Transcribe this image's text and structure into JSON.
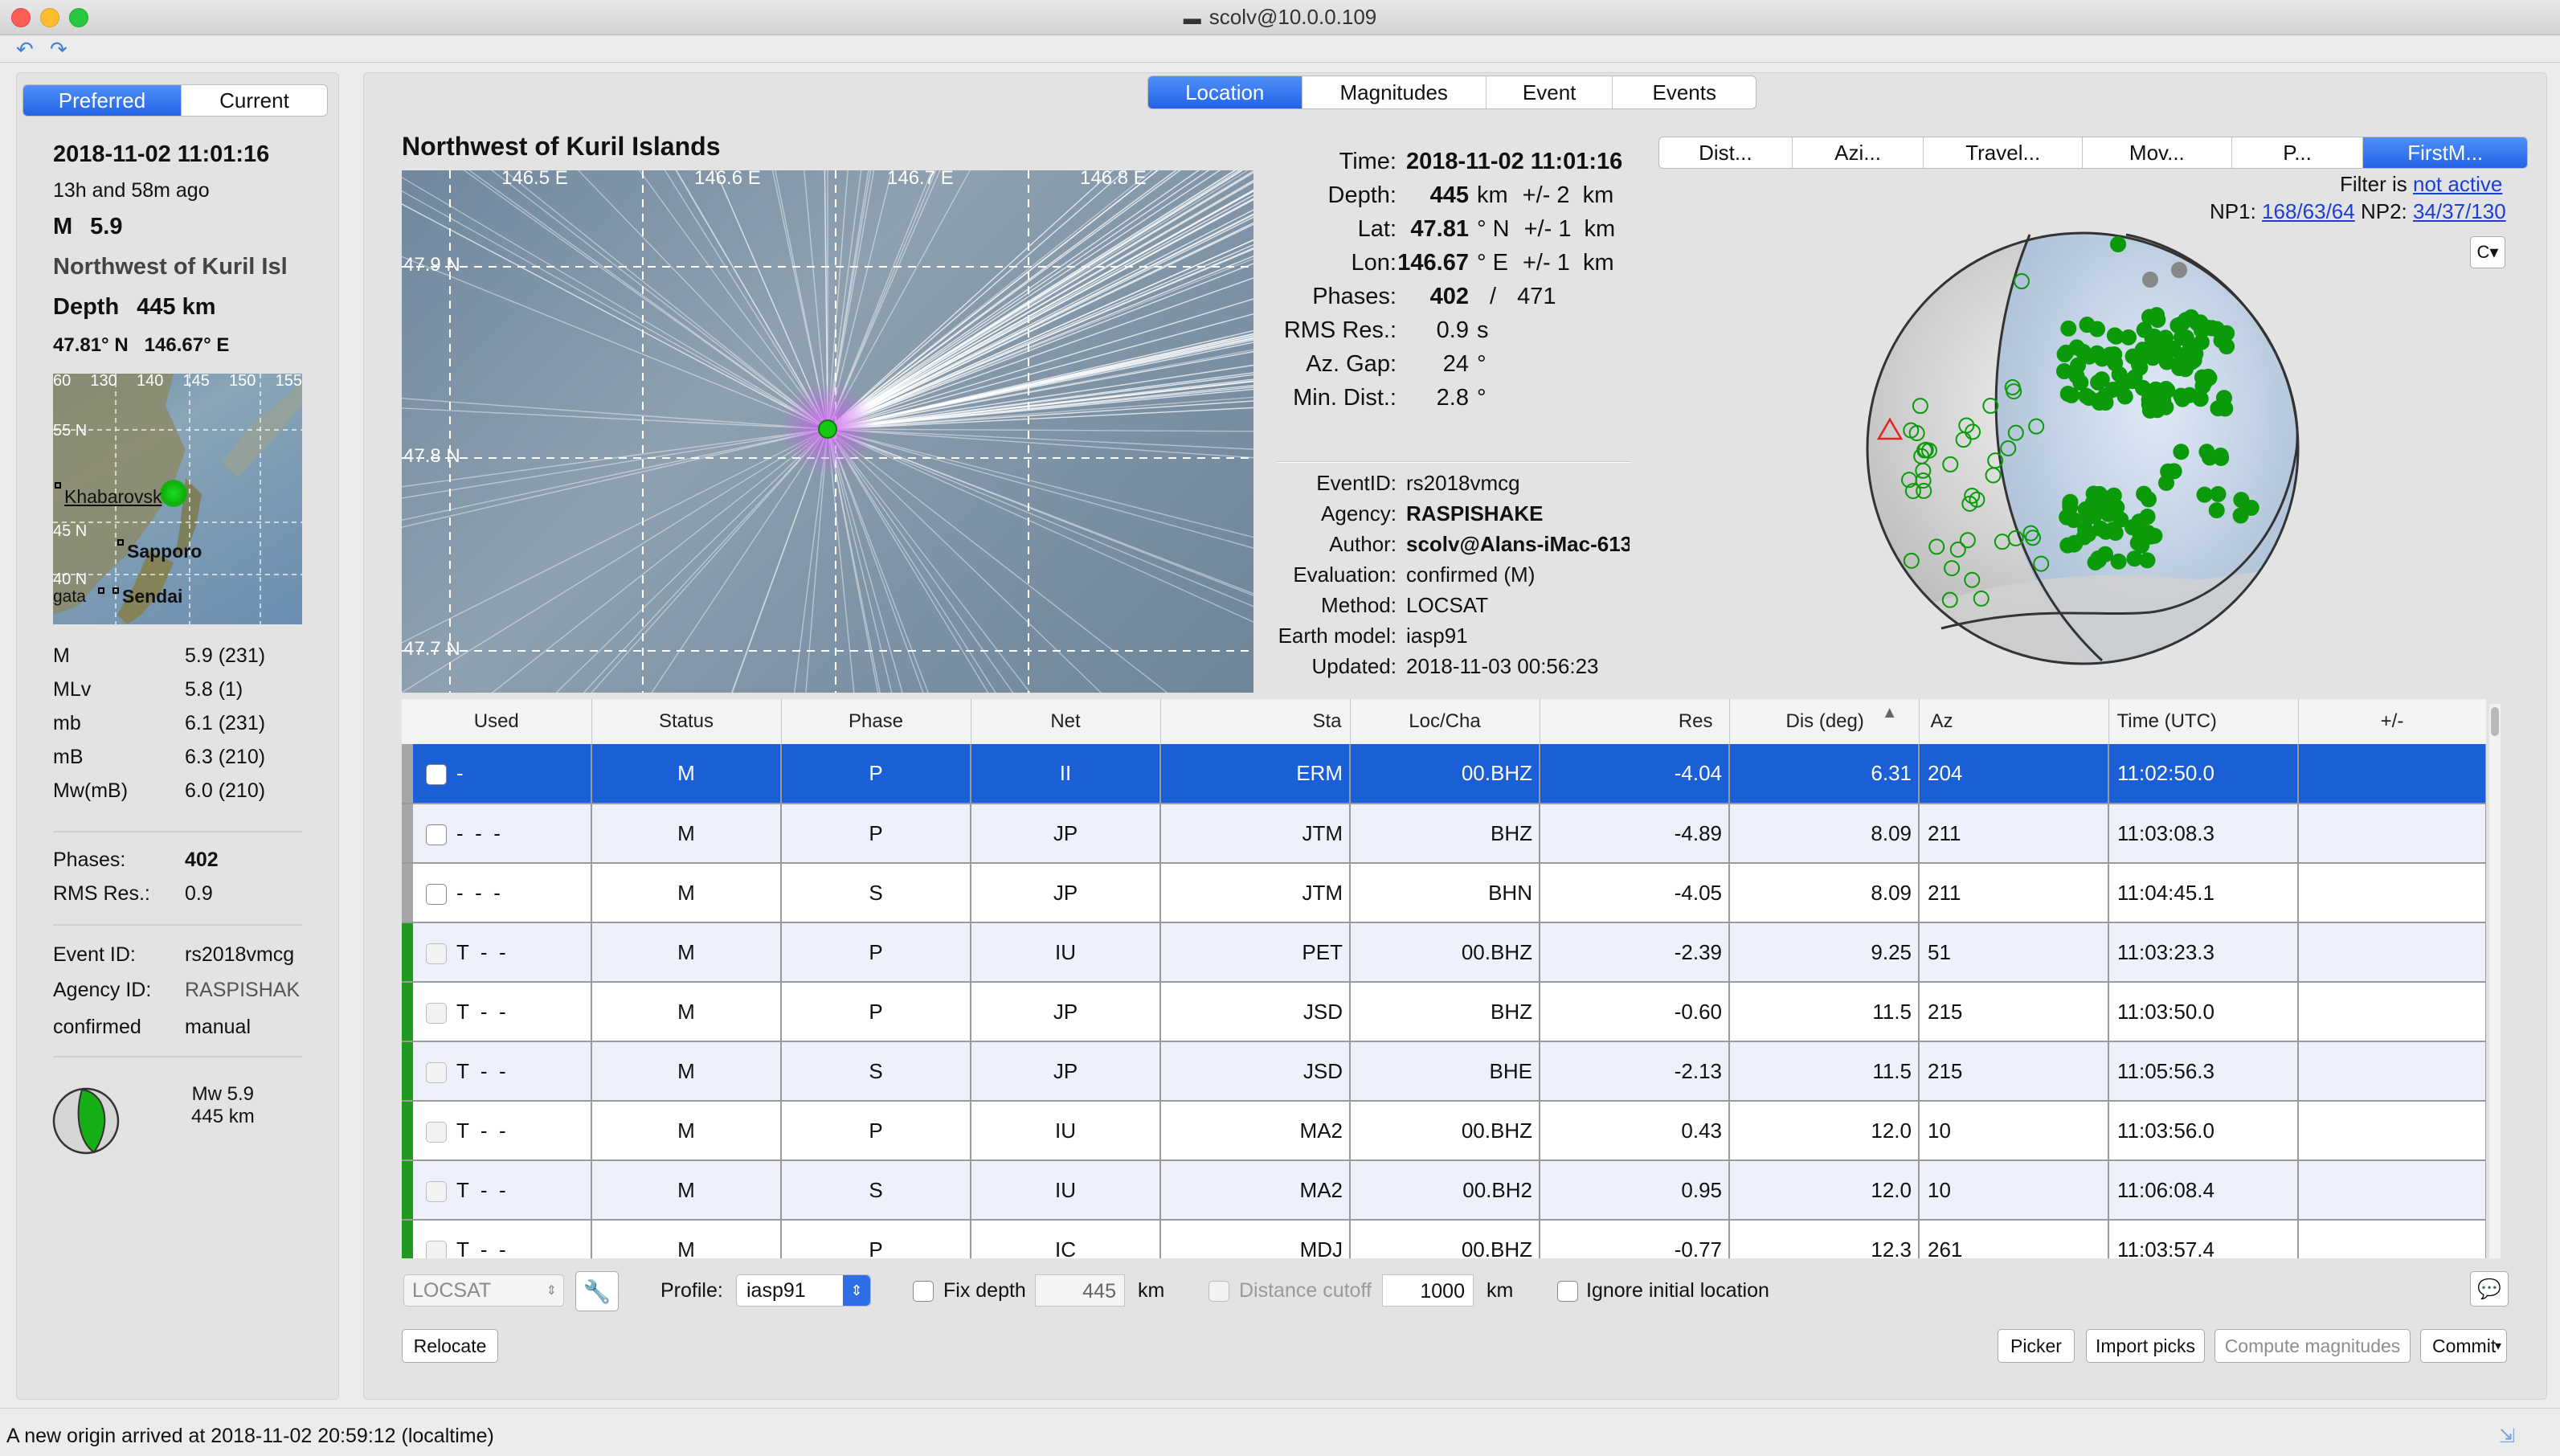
{
  "window": {
    "title": "scolv@10.0.0.109"
  },
  "left": {
    "tab_preferred": "Preferred",
    "tab_current": "Current",
    "time": "2018-11-02 11:01:16",
    "ago": "13h and 58m ago",
    "mag_label": "M",
    "mag_value": "5.9",
    "region": "Northwest of Kuril Isl",
    "depth_label": "Depth",
    "depth_value": "445 km",
    "coords": "47.81° N   146.67° E",
    "map": {
      "top_ticks": [
        "60",
        "130",
        "140",
        "145",
        "150",
        "155"
      ],
      "left_ticks": [
        "55 N",
        "45 N",
        "40 N"
      ],
      "cities": [
        "Khabarovsk",
        "Sapporo",
        "Sendai",
        "gata"
      ]
    },
    "mags": [
      {
        "name": "M",
        "value": "5.9 (231)"
      },
      {
        "name": "MLv",
        "value": "5.8 (1)"
      },
      {
        "name": "mb",
        "value": "6.1 (231)"
      },
      {
        "name": "mB",
        "value": "6.3 (210)"
      },
      {
        "name": "Mw(mB)",
        "value": "6.0 (210)"
      }
    ],
    "phases_label": "Phases:",
    "phases_value": "402",
    "rms_label": "RMS Res.:",
    "rms_value": "0.9",
    "eventid_label": "Event ID:",
    "eventid_value": "rs2018vmcg",
    "agency_label": "Agency ID:",
    "agency_value": "RASPISHAK",
    "status_label": "confirmed",
    "status_value": "manual",
    "fm_mag": "Mw 5.9",
    "fm_depth": "445 km"
  },
  "tabs": {
    "location": "Location",
    "magnitudes": "Magnitudes",
    "event": "Event",
    "events": "Events"
  },
  "map": {
    "title": "Northwest of Kuril Islands",
    "lon_labels": [
      "146.5 E",
      "146.6 E",
      "146.7 E",
      "146.8 E"
    ],
    "lat_labels": [
      "47.9 N",
      "47.8 N",
      "47.7 N"
    ]
  },
  "info": {
    "time_label": "Time:",
    "time_value": "2018-11-02 11:01:16",
    "depth_label": "Depth:",
    "depth_value": "445",
    "depth_unit": "km",
    "depth_err": "+/- 2  km",
    "lat_label": "Lat:",
    "lat_value": "47.81",
    "lat_unit": "° N",
    "lat_err": "+/- 1  km",
    "lon_label": "Lon:",
    "lon_value": "146.67",
    "lon_unit": "° E",
    "lon_err": "+/- 1  km",
    "phases_label": "Phases:",
    "phases_used": "402",
    "phases_sep": "/",
    "phases_total": "471",
    "rms_label": "RMS Res.:",
    "rms_value": "0.9",
    "rms_unit": "s",
    "azgap_label": "Az. Gap:",
    "azgap_value": "24",
    "azgap_unit": "°",
    "mindist_label": "Min. Dist.:",
    "mindist_value": "2.8",
    "mindist_unit": "°",
    "eventid_label": "EventID:",
    "eventid_value": "rs2018vmcg",
    "agency_label": "Agency:",
    "agency_value": "RASPISHAKE",
    "author_label": "Author:",
    "author_value": "scolv@Alans-iMac-613",
    "eval_label": "Evaluation:",
    "eval_value": "confirmed (M)",
    "method_label": "Method:",
    "method_value": "LOCSAT",
    "earth_label": "Earth model:",
    "earth_value": "iasp91",
    "updated_label": "Updated:",
    "updated_value": "2018-11-03 00:56:23"
  },
  "plot_tabs": [
    "Dist...",
    "Azi...",
    "Travel...",
    "Mov...",
    "P...",
    "FirstM..."
  ],
  "filter": {
    "prefix": "Filter is",
    "link": "not active"
  },
  "np": {
    "np1_label": "NP1:",
    "np1_value": "168/63/64",
    "np2_label": "NP2:",
    "np2_value": "34/37/130"
  },
  "table": {
    "headers": [
      "Used",
      "Status",
      "Phase",
      "Net",
      "Sta",
      "Loc/Cha",
      "Res",
      "Dis (deg)",
      "Az",
      "Time (UTC)",
      "+/-"
    ],
    "sort_indicator": "▲",
    "rows": [
      {
        "used": "-",
        "status": "M",
        "phase": "P",
        "net": "II",
        "sta": "ERM",
        "loccha": "00.BHZ",
        "res": "-4.04",
        "dis": "6.31",
        "az": "204",
        "time": "11:02:50.0",
        "pm": ""
      },
      {
        "used": "-  -  -",
        "status": "M",
        "phase": "P",
        "net": "JP",
        "sta": "JTM",
        "loccha": "BHZ",
        "res": "-4.89",
        "dis": "8.09",
        "az": "211",
        "time": "11:03:08.3",
        "pm": ""
      },
      {
        "used": "-  -  -",
        "status": "M",
        "phase": "S",
        "net": "JP",
        "sta": "JTM",
        "loccha": "BHN",
        "res": "-4.05",
        "dis": "8.09",
        "az": "211",
        "time": "11:04:45.1",
        "pm": ""
      },
      {
        "used": "T  -  -",
        "status": "M",
        "phase": "P",
        "net": "IU",
        "sta": "PET",
        "loccha": "00.BHZ",
        "res": "-2.39",
        "dis": "9.25",
        "az": "51",
        "time": "11:03:23.3",
        "pm": ""
      },
      {
        "used": "T  -  -",
        "status": "M",
        "phase": "P",
        "net": "JP",
        "sta": "JSD",
        "loccha": "BHZ",
        "res": "-0.60",
        "dis": "11.5",
        "az": "215",
        "time": "11:03:50.0",
        "pm": ""
      },
      {
        "used": "T  -  -",
        "status": "M",
        "phase": "S",
        "net": "JP",
        "sta": "JSD",
        "loccha": "BHE",
        "res": "-2.13",
        "dis": "11.5",
        "az": "215",
        "time": "11:05:56.3",
        "pm": ""
      },
      {
        "used": "T  -  -",
        "status": "M",
        "phase": "P",
        "net": "IU",
        "sta": "MA2",
        "loccha": "00.BHZ",
        "res": "0.43",
        "dis": "12.0",
        "az": "10",
        "time": "11:03:56.0",
        "pm": ""
      },
      {
        "used": "T  -  -",
        "status": "M",
        "phase": "S",
        "net": "IU",
        "sta": "MA2",
        "loccha": "00.BH2",
        "res": "0.95",
        "dis": "12.0",
        "az": "10",
        "time": "11:06:08.4",
        "pm": ""
      },
      {
        "used": "T  -  -",
        "status": "M",
        "phase": "P",
        "net": "IC",
        "sta": "MDJ",
        "loccha": "00.BHZ",
        "res": "-0.77",
        "dis": "12.3",
        "az": "261",
        "time": "11:03:57.4",
        "pm": ""
      }
    ]
  },
  "controls": {
    "locator": "LOCSAT",
    "profile_label": "Profile:",
    "profile_value": "iasp91",
    "fixdepth_label": "Fix depth",
    "fixdepth_value": "445",
    "km1": "km",
    "cutoff_label": "Distance cutoff",
    "cutoff_value": "1000",
    "km2": "km",
    "ignore_label": "Ignore initial location",
    "relocate": "Relocate",
    "picker": "Picker",
    "import": "Import picks",
    "compute": "Compute magnitudes",
    "commit": "Commit"
  },
  "status": {
    "text": "A new origin arrived at 2018-11-02 20:59:12 (localtime)"
  },
  "colors": {
    "accent": "#2264e6",
    "selected_row": "#1b5fd6",
    "used_bar": "#1f9a1f",
    "pick_green": "#0a9a0a"
  }
}
